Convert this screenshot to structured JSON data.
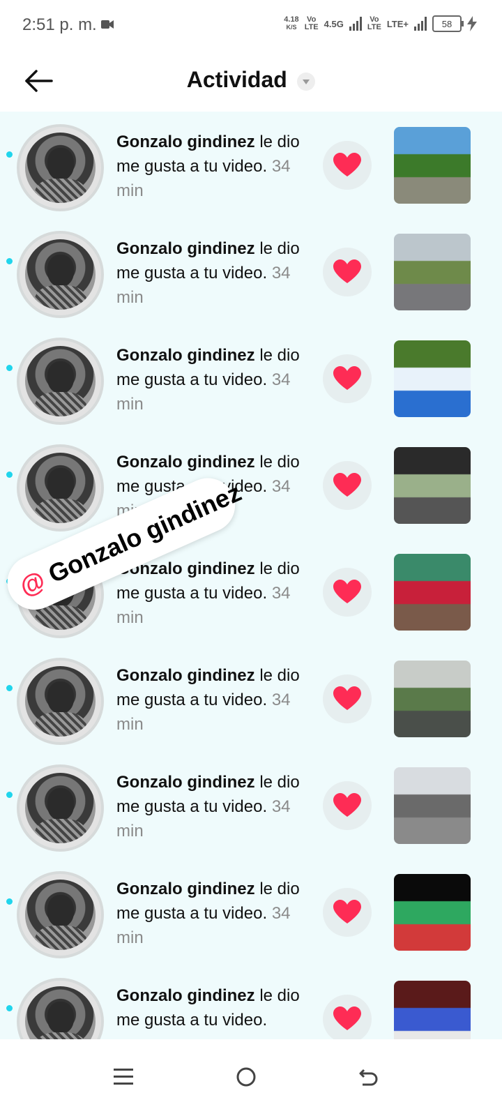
{
  "status_bar": {
    "time": "2:51 p. m.",
    "net_speed_value": "4.18",
    "net_speed_unit": "K/S",
    "volte1_top": "Vo",
    "volte1_bottom": "LTE",
    "network1": "4.5G",
    "volte2_top": "Vo",
    "volte2_bottom": "LTE",
    "network2": "LTE+",
    "battery": "58"
  },
  "header": {
    "title": "Actividad"
  },
  "sticker": {
    "at": "@",
    "name": "Gonzalo gindinez"
  },
  "notifications": [
    {
      "user": "Gonzalo gindinez",
      "action": " le dio me gusta a tu video.",
      "time": "34 min",
      "thumb": "road-trees"
    },
    {
      "user": "Gonzalo gindinez",
      "action": " le dio me gusta a tu video.",
      "time": "34 min",
      "thumb": "road-buildings"
    },
    {
      "user": "Gonzalo gindinez",
      "action": " le dio me gusta a tu video.",
      "time": "34 min",
      "thumb": "two-players"
    },
    {
      "user": "Gonzalo gindinez",
      "action": " le dio me gusta a tu video.",
      "time": "34 min",
      "thumb": "car-interior"
    },
    {
      "user": "Gonzalo gindinez",
      "action": " le dio me gusta a tu video.",
      "time": "34 min",
      "thumb": "woman-red"
    },
    {
      "user": "Gonzalo gindinez",
      "action": " le dio me gusta a tu video.",
      "time": "34 min",
      "thumb": "road-rain"
    },
    {
      "user": "Gonzalo gindinez",
      "action": " le dio me gusta a tu video.",
      "time": "34 min",
      "thumb": "street-town"
    },
    {
      "user": "Gonzalo gindinez",
      "action": " le dio me gusta a tu video.",
      "time": "34 min",
      "thumb": "party-hall"
    },
    {
      "user": "Gonzalo gindinez",
      "action": " le dio me gusta a tu video.",
      "time": "",
      "thumb": "flowers"
    }
  ],
  "thumb_colors": {
    "road-trees": [
      "#5aa0d8",
      "#3c7a2a",
      "#8a8a7a"
    ],
    "road-buildings": [
      "#bcc6cc",
      "#6e8a4a",
      "#77777a"
    ],
    "two-players": [
      "#4a7a2c",
      "#e8f2fa",
      "#2a6fd0"
    ],
    "car-interior": [
      "#2a2a2a",
      "#9ab08a",
      "#555555"
    ],
    "woman-red": [
      "#3a8a6a",
      "#c8203a",
      "#7a5a4a"
    ],
    "road-rain": [
      "#c8ccc8",
      "#5a7a4a",
      "#4a4f4a"
    ],
    "street-town": [
      "#d8dce0",
      "#6a6a6a",
      "#8a8a8a"
    ],
    "party-hall": [
      "#0a0a0a",
      "#2ea860",
      "#d23a3a"
    ],
    "flowers": [
      "#5a1a1a",
      "#3a5ad0",
      "#e8e8e8"
    ]
  },
  "colors": {
    "accent": "#20d5ec",
    "heart": "#fe2c55",
    "list_bg": "#effbfc"
  },
  "navbar": {
    "items": [
      "menu-icon",
      "home-icon",
      "back-icon"
    ]
  }
}
